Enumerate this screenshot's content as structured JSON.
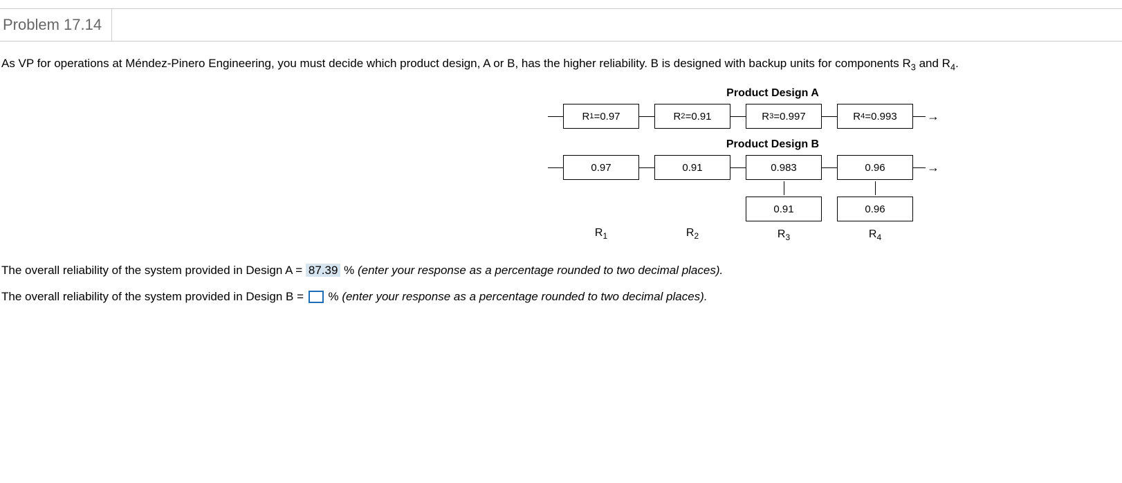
{
  "header": {
    "title": "Problem 17.14"
  },
  "prompt": {
    "p1": "As VP for operations at Méndez-Pinero Engineering, you must decide which product design, A or B, has the higher reliability. B is designed with backup units for components R",
    "sub1": "3",
    "p2": " and R",
    "sub2": "4",
    "p3": "."
  },
  "designA": {
    "title": "Product Design A",
    "r1": {
      "prefix": "R",
      "sub": "1",
      "eq": "=0.97"
    },
    "r2": {
      "prefix": "R",
      "sub": "2",
      "eq": "=0.91"
    },
    "r3": {
      "prefix": "R",
      "sub": "3",
      "eq": "=0.997"
    },
    "r4": {
      "prefix": "R",
      "sub": "4",
      "eq": "=0.993"
    }
  },
  "designB": {
    "title": "Product Design B",
    "r1": "0.97",
    "r2": "0.91",
    "r3": "0.983",
    "r3b": "0.91",
    "r4": "0.96",
    "r4b": "0.96",
    "labels": {
      "l1p": "R",
      "l1s": "1",
      "l2p": "R",
      "l2s": "2",
      "l3p": "R",
      "l3s": "3",
      "l4p": "R",
      "l4s": "4"
    }
  },
  "answers": {
    "a1_pre": "The overall reliability of the system provided in Design A = ",
    "a1_val": "87.39",
    "a1_post": " % ",
    "a1_hint": "(enter your response as a percentage rounded to two decimal places).",
    "b1_pre": "The overall reliability of the system provided in Design B = ",
    "b1_post": "% ",
    "b1_hint": "(enter your response as a percentage rounded to two decimal places)."
  },
  "chart_data": {
    "type": "table",
    "title": "Component Reliabilities",
    "designs": [
      {
        "name": "Product Design A",
        "components": [
          {
            "name": "R1",
            "reliability": 0.97
          },
          {
            "name": "R2",
            "reliability": 0.91
          },
          {
            "name": "R3",
            "reliability": 0.997
          },
          {
            "name": "R4",
            "reliability": 0.993
          }
        ],
        "overall_reliability_pct": 87.39
      },
      {
        "name": "Product Design B",
        "components": [
          {
            "name": "R1",
            "reliability": 0.97
          },
          {
            "name": "R2",
            "reliability": 0.91
          },
          {
            "name": "R3",
            "reliability": 0.983,
            "backup": 0.91
          },
          {
            "name": "R4",
            "reliability": 0.96,
            "backup": 0.96
          }
        ]
      }
    ]
  }
}
